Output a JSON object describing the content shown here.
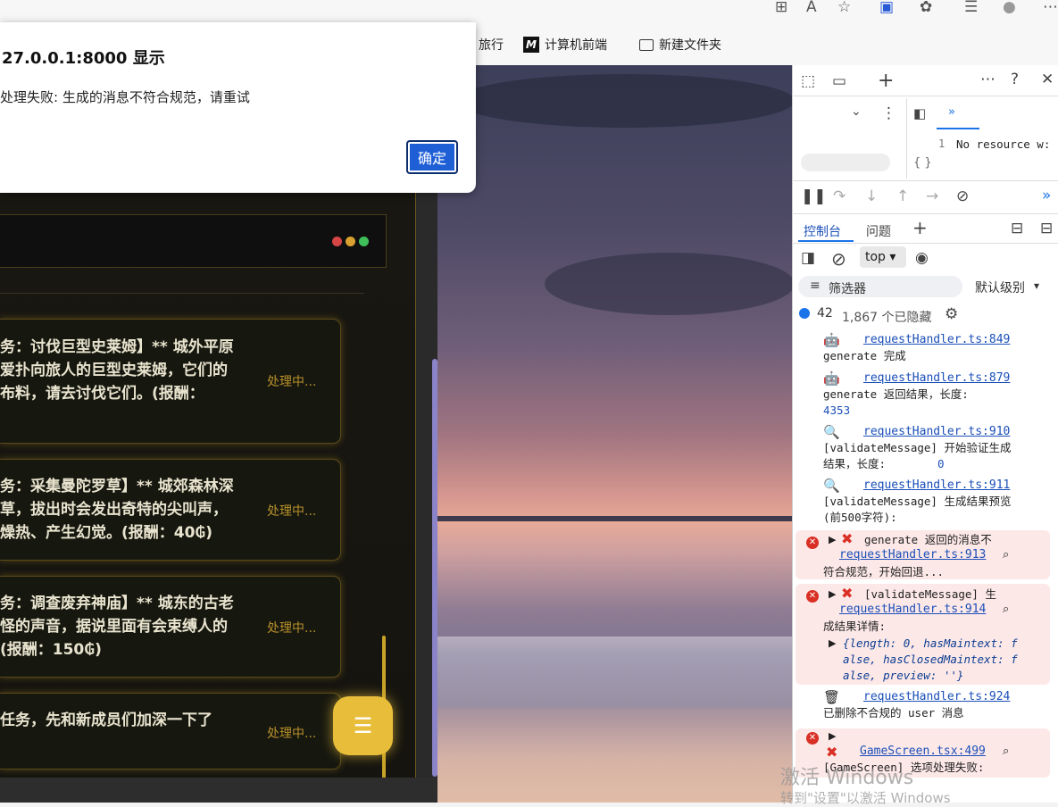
{
  "alert": {
    "title": "27.0.0.1:8000 显示",
    "message": "处理失败: 生成的消息不符合规范，请重试",
    "ok_label": "确定"
  },
  "bookmarks": [
    {
      "label": "旅行"
    },
    {
      "label": "计算机前端",
      "icon": "M"
    },
    {
      "label": "新建文件夹"
    }
  ],
  "quests": [
    {
      "text": "务：讨伐巨型史莱姆】** 城外平原\n爱扑向旅人的巨型史莱姆，它们的\n布料，请去讨伐它们。(报酬：",
      "status": "处理中..."
    },
    {
      "text": "务：采集曼陀罗草】** 城郊森林深\n草，拔出时会发出奇特的尖叫声，\n燥热、产生幻觉。(报酬：40₲)",
      "status": "处理中..."
    },
    {
      "text": "务：调查废弃神庙】** 城东的古老\n怪的声音，据说里面有会束缚人的\n(报酬：150₲)",
      "status": "处理中..."
    },
    {
      "text": "任务，先和新成员们加深一下了",
      "status": "处理中..."
    }
  ],
  "fab_icon": "menu-icon",
  "devtools": {
    "sources_line_no": "1",
    "sources_text": "No resource w:",
    "braces": "{ }",
    "tabs": {
      "console": "控制台",
      "issues": "问题"
    },
    "context": "top",
    "filter_placeholder": "筛选器",
    "level": "默认级别",
    "message_count": "42",
    "hidden_count": "1,867 个已隐藏",
    "logs": [
      {
        "link": "requestHandler.ts:849",
        "text": "generate 完成"
      },
      {
        "link": "requestHandler.ts:879",
        "text": "generate 返回结果，长度:",
        "value": "4353"
      },
      {
        "link": "requestHandler.ts:910",
        "text": "[validateMessage] 开始验证生成结果，长度:",
        "value": "0"
      },
      {
        "link": "requestHandler.ts:911",
        "text": "[validateMessage] 生成结果预览 (前500字符):"
      },
      {
        "error": true,
        "head": "generate 返回的消息不",
        "link": "requestHandler.ts:913",
        "text": "符合规范，开始回退..."
      },
      {
        "error": true,
        "head": "[validateMessage] 生",
        "link": "requestHandler.ts:914",
        "text": "成结果详情:",
        "object": "{length: 0, hasMaintext: false, hasClosedMaintext: false, preview: ''}"
      },
      {
        "link": "requestHandler.ts:924",
        "text": "已删除不合规的 user 消息"
      },
      {
        "error": true,
        "link": "GameScreen.tsx:499",
        "text": "[GameScreen] 选项处理失败:"
      }
    ]
  },
  "watermark": {
    "line1": "激活 Windows",
    "line2": "转到\"设置\"以激活 Windows"
  }
}
